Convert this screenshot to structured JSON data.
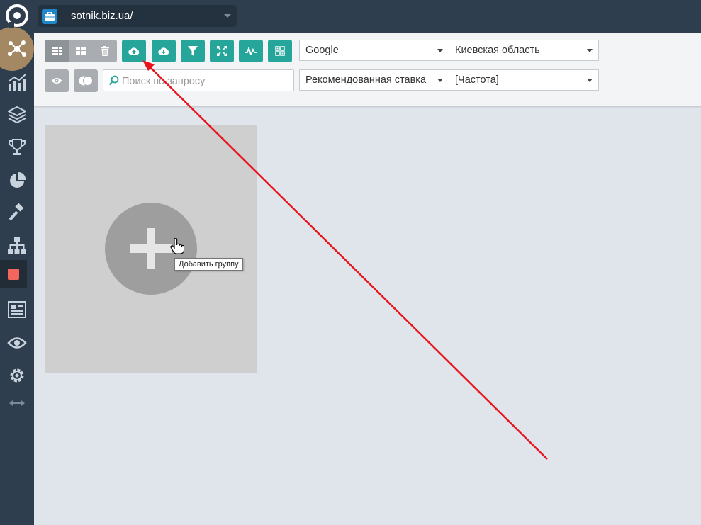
{
  "project": {
    "name": "sotnik.biz.ua/"
  },
  "sidebar": {
    "items": [
      {
        "icon": "logo-icon"
      },
      {
        "icon": "network-icon",
        "active": true
      },
      {
        "icon": "chart-icon"
      },
      {
        "icon": "layers-icon"
      },
      {
        "icon": "trophy-icon"
      },
      {
        "icon": "pie-icon"
      },
      {
        "icon": "gavel-icon"
      },
      {
        "icon": "sitemap-icon"
      },
      {
        "icon": "red-square-icon"
      },
      {
        "icon": "list-icon"
      },
      {
        "icon": "eye-icon"
      },
      {
        "icon": "gear-icon"
      },
      {
        "icon": "expand-icon"
      }
    ]
  },
  "toolbar": {
    "search_placeholder": "Поиск по запросу",
    "engine": "Google",
    "region": "Киевская область",
    "bid": "Рекомендованная ставка",
    "frequency": "[Частота]"
  },
  "main": {
    "add_group_tooltip": "Добавить группу"
  },
  "colors": {
    "sidebar_bg": "#2e3e4e",
    "teal": "#26a69a",
    "accent_red": "#f2665e",
    "annotation_arrow": "#e8131b"
  }
}
